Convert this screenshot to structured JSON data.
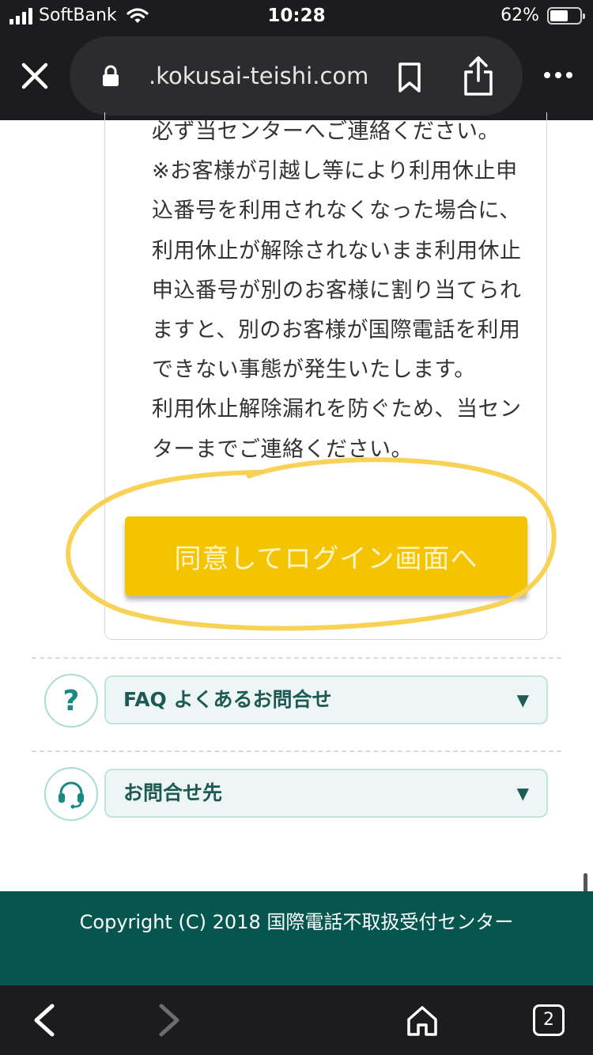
{
  "status_bar": {
    "carrier": "SoftBank",
    "time": "10:28",
    "battery_percent": "62%",
    "battery_level": 0.62
  },
  "browser": {
    "url": ".kokusai-teishi.com"
  },
  "notice": {
    "text": "必ず当センターへご連絡ください。\n※お客様が引越し等により利用休止申込番号を利用されなくなった場合に、利用休止が解除されないまま利用休止申込番号が別のお客様に割り当てられますと、別のお客様が国際電話を利用できない事態が発生いたします。\n利用休止解除漏れを防ぐため、当センターまでご連絡ください。"
  },
  "login_button": {
    "label": "同意してログイン画面へ"
  },
  "accordions": [
    {
      "label": "FAQ よくあるお問合せ",
      "icon": "question-icon",
      "arrow": "▼"
    },
    {
      "label": "お問合せ先",
      "icon": "headset-icon",
      "arrow": "▼"
    }
  ],
  "footer": {
    "copyright": "Copyright (C) 2018 国際電話不取扱受付センター"
  },
  "bottom_bar": {
    "tab_count": "2"
  },
  "colors": {
    "button_yellow": "#f5c400",
    "highlight_stroke": "#f7d256",
    "footer_green": "#06564f",
    "accent_teal": "#1a8a80"
  }
}
